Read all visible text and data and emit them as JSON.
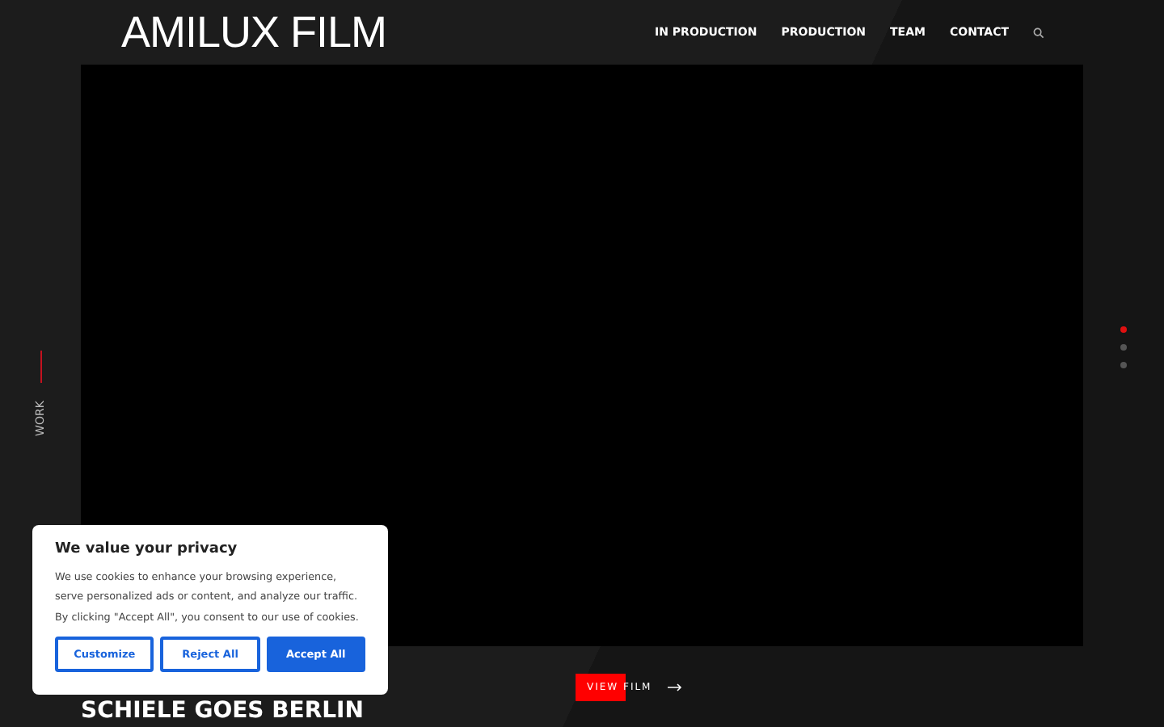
{
  "logo": "AMILUX FILM",
  "nav": [
    {
      "label": "IN PRODUCTION"
    },
    {
      "label": "PRODUCTION"
    },
    {
      "label": "TEAM"
    },
    {
      "label": "CONTACT"
    }
  ],
  "side_label": "WORK",
  "slides": [
    {
      "selected": true
    },
    {
      "selected": false
    },
    {
      "selected": false
    }
  ],
  "film": {
    "title": "SCHIELE GOES BERLIN",
    "action": "VIEW FILM"
  },
  "cookie_dialog": {
    "title": "We value your privacy",
    "text": "We use cookies to enhance your browsing experience, serve personalized ads or content, and analyze our traffic. By clicking \"Accept All\", you consent to our use of cookies.",
    "buttons": [
      {
        "label": "Customize",
        "kind": "outline"
      },
      {
        "label": "Reject All",
        "kind": "outline"
      },
      {
        "label": "Accept All",
        "kind": "primary"
      }
    ]
  }
}
